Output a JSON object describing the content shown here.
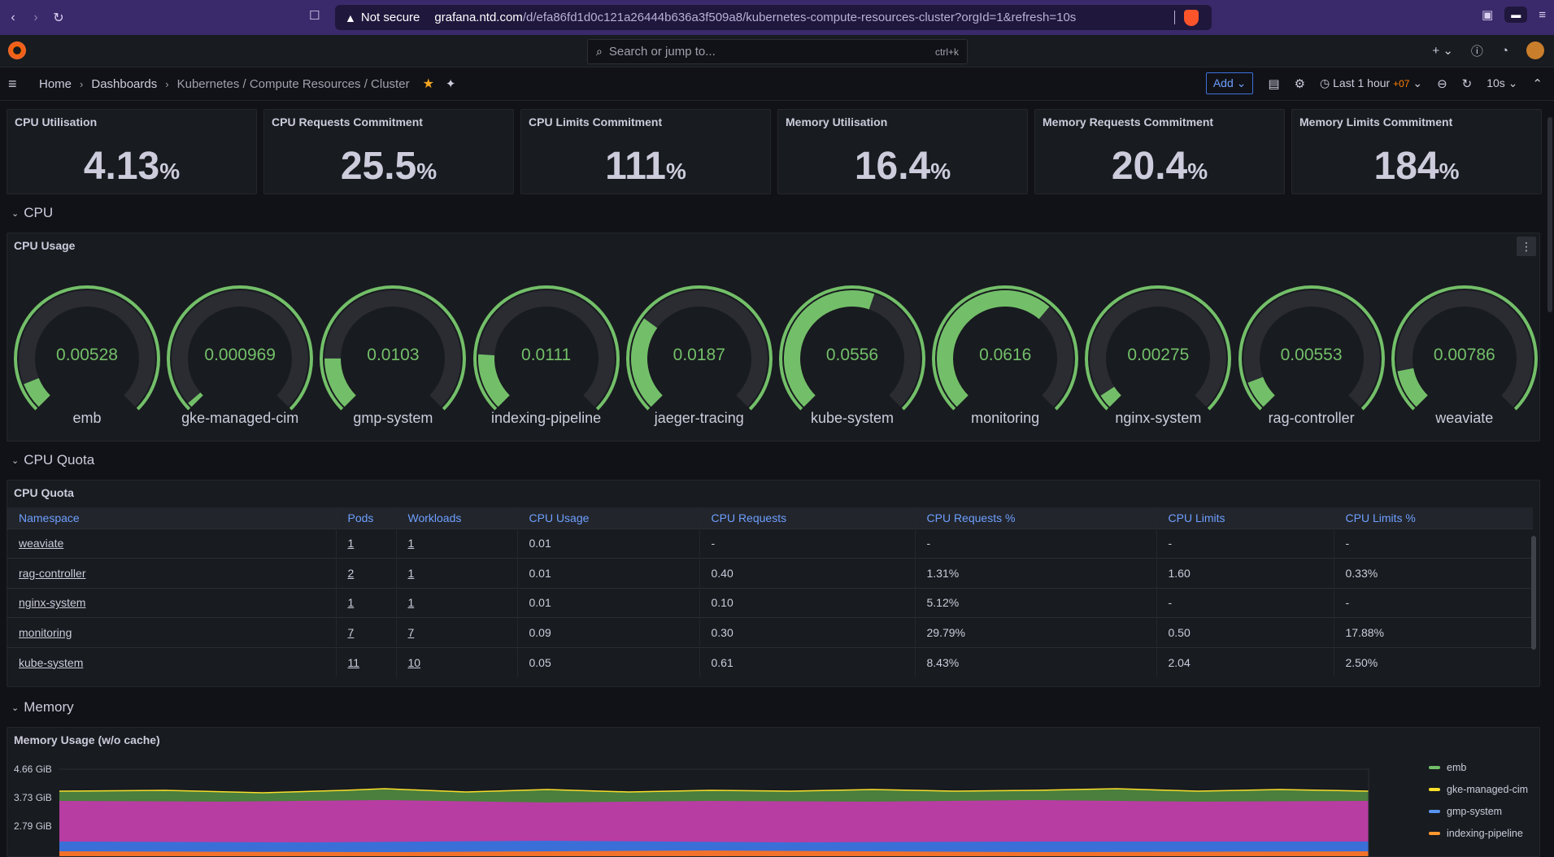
{
  "browser": {
    "security": "Not secure",
    "url_host": "grafana.ntd.com",
    "url_path": "/d/efa86fd1d0c121a26444b636a3f509a8/kubernetes-compute-resources-cluster?orgId=1&refresh=10s"
  },
  "search": {
    "placeholder": "Search or jump to...",
    "shortcut": "ctrl+k"
  },
  "breadcrumb": {
    "home": "Home",
    "dashboards": "Dashboards",
    "current": "Kubernetes / Compute Resources / Cluster"
  },
  "toolbar": {
    "add_label": "Add",
    "time_range": "Last 1 hour",
    "timezone": "+07",
    "refresh": "10s"
  },
  "stats": [
    {
      "title": "CPU Utilisation",
      "value": "4.13",
      "unit": "%"
    },
    {
      "title": "CPU Requests Commitment",
      "value": "25.5",
      "unit": "%"
    },
    {
      "title": "CPU Limits Commitment",
      "value": "111",
      "unit": "%"
    },
    {
      "title": "Memory Utilisation",
      "value": "16.4",
      "unit": "%"
    },
    {
      "title": "Memory Requests Commitment",
      "value": "20.4",
      "unit": "%"
    },
    {
      "title": "Memory Limits Commitment",
      "value": "184",
      "unit": "%"
    }
  ],
  "rows": {
    "cpu": "CPU",
    "cpu_quota": "CPU Quota",
    "memory": "Memory"
  },
  "cpu_usage": {
    "title": "CPU Usage",
    "gauges": [
      {
        "name": "emb",
        "value": "0.00528",
        "fraction": 0.085
      },
      {
        "name": "gke-managed-cim",
        "value": "0.000969",
        "fraction": 0.016
      },
      {
        "name": "gmp-system",
        "value": "0.0103",
        "fraction": 0.167
      },
      {
        "name": "indexing-pipeline",
        "value": "0.0111",
        "fraction": 0.18
      },
      {
        "name": "jaeger-tracing",
        "value": "0.0187",
        "fraction": 0.3
      },
      {
        "name": "kube-system",
        "value": "0.0556",
        "fraction": 0.57
      },
      {
        "name": "monitoring",
        "value": "0.0616",
        "fraction": 0.65
      },
      {
        "name": "nginx-system",
        "value": "0.00275",
        "fraction": 0.045
      },
      {
        "name": "rag-controller",
        "value": "0.00553",
        "fraction": 0.09
      },
      {
        "name": "weaviate",
        "value": "0.00786",
        "fraction": 0.127
      }
    ],
    "color": "#73bf69"
  },
  "cpu_quota": {
    "title": "CPU Quota",
    "columns": [
      "Namespace",
      "Pods",
      "Workloads",
      "CPU Usage",
      "CPU Requests",
      "CPU Requests %",
      "CPU Limits",
      "CPU Limits %"
    ],
    "rows": [
      [
        "weaviate",
        "1",
        "1",
        "0.01",
        "-",
        "-",
        "-",
        "-"
      ],
      [
        "rag-controller",
        "2",
        "1",
        "0.01",
        "0.40",
        "1.31%",
        "1.60",
        "0.33%"
      ],
      [
        "nginx-system",
        "1",
        "1",
        "0.01",
        "0.10",
        "5.12%",
        "-",
        "-"
      ],
      [
        "monitoring",
        "7",
        "7",
        "0.09",
        "0.30",
        "29.79%",
        "0.50",
        "17.88%"
      ],
      [
        "kube-system",
        "11",
        "10",
        "0.05",
        "0.61",
        "8.43%",
        "2.04",
        "2.50%"
      ]
    ]
  },
  "memory_usage": {
    "title": "Memory Usage (w/o cache)",
    "y_ticks": [
      "4.66 GiB",
      "3.73 GiB",
      "2.79 GiB"
    ],
    "legend": [
      {
        "name": "emb",
        "color": "#73bf69"
      },
      {
        "name": "gke-managed-cim",
        "color": "#fade2a"
      },
      {
        "name": "gmp-system",
        "color": "#5794f2"
      },
      {
        "name": "indexing-pipeline",
        "color": "#ff9830"
      }
    ]
  }
}
